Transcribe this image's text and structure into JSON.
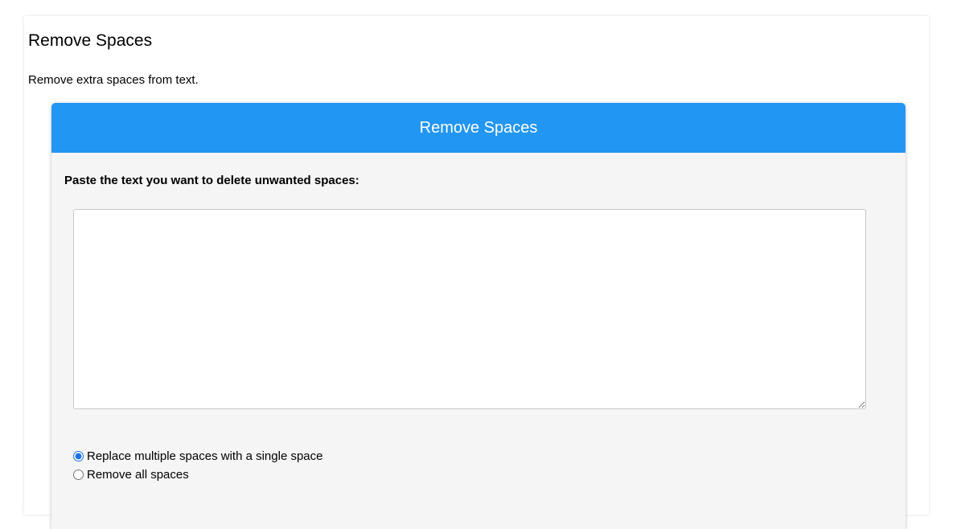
{
  "page": {
    "title": "Remove Spaces",
    "description": "Remove extra spaces from text."
  },
  "tool": {
    "header": "Remove Spaces",
    "input_label": "Paste the text you want to delete unwanted spaces:",
    "input_value": "",
    "options": [
      {
        "label": "Replace multiple spaces with a single space",
        "selected": true
      },
      {
        "label": "Remove all spaces",
        "selected": false
      }
    ]
  },
  "colors": {
    "header_bg": "#2196f3",
    "card_bg": "#f5f5f5"
  }
}
